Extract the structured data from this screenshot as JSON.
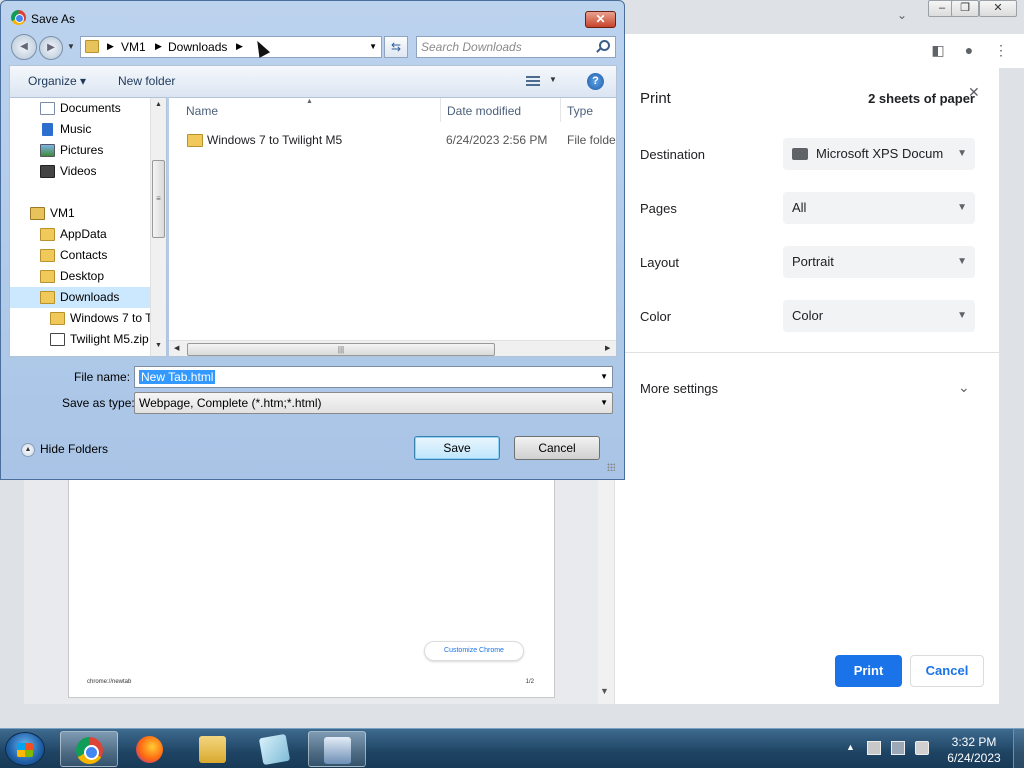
{
  "dialog": {
    "title": "Save As",
    "breadcrumb": [
      "VM1",
      "Downloads"
    ],
    "search_placeholder": "Search Downloads",
    "toolbar": {
      "organize": "Organize",
      "new_folder": "New folder"
    },
    "nav_items": [
      {
        "label": "Documents",
        "icon": "documents-icon"
      },
      {
        "label": "Music",
        "icon": "music-icon"
      },
      {
        "label": "Pictures",
        "icon": "pictures-icon"
      },
      {
        "label": "Videos",
        "icon": "videos-icon"
      },
      {
        "label": "VM1",
        "icon": "user-folder-icon"
      },
      {
        "label": "AppData",
        "icon": "folder-icon"
      },
      {
        "label": "Contacts",
        "icon": "contacts-icon"
      },
      {
        "label": "Desktop",
        "icon": "desktop-icon"
      },
      {
        "label": "Downloads",
        "icon": "downloads-icon",
        "selected": true
      },
      {
        "label": "Windows 7 to T",
        "icon": "folder-icon"
      },
      {
        "label": "Twilight M5.zip",
        "icon": "zip-file-icon"
      }
    ],
    "columns": [
      "Name",
      "Date modified",
      "Type"
    ],
    "files": [
      {
        "name": "Windows 7 to Twilight M5",
        "date_modified": "6/24/2023 2:56 PM",
        "type": "File folder"
      }
    ],
    "file_name_label": "File name:",
    "file_name_value": "New Tab.html",
    "save_type_label": "Save as type:",
    "save_type_value": "Webpage, Complete (*.htm;*.html)",
    "hide_folders": "Hide Folders",
    "save": "Save",
    "cancel": "Cancel",
    "close": "✕"
  },
  "print_panel": {
    "title": "Print",
    "sheets": "2 sheets of paper",
    "rows": [
      {
        "label": "Destination",
        "value": "Microsoft XPS Docum"
      },
      {
        "label": "Pages",
        "value": "All"
      },
      {
        "label": "Layout",
        "value": "Portrait"
      },
      {
        "label": "Color",
        "value": "Color"
      }
    ],
    "more_settings": "More settings",
    "print": "Print",
    "cancel": "Cancel",
    "accent_color": "#1a73e8"
  },
  "preview": {
    "customize_button": "Customize Chrome",
    "url": "chrome://newtab",
    "page_number": "1/2"
  },
  "taskbar": {
    "apps": [
      "chrome-icon",
      "firefox-icon",
      "file-explorer-icon",
      "notepad-icon",
      "on-screen-keyboard-icon"
    ],
    "time": "3:32 PM",
    "date": "6/24/2023"
  }
}
